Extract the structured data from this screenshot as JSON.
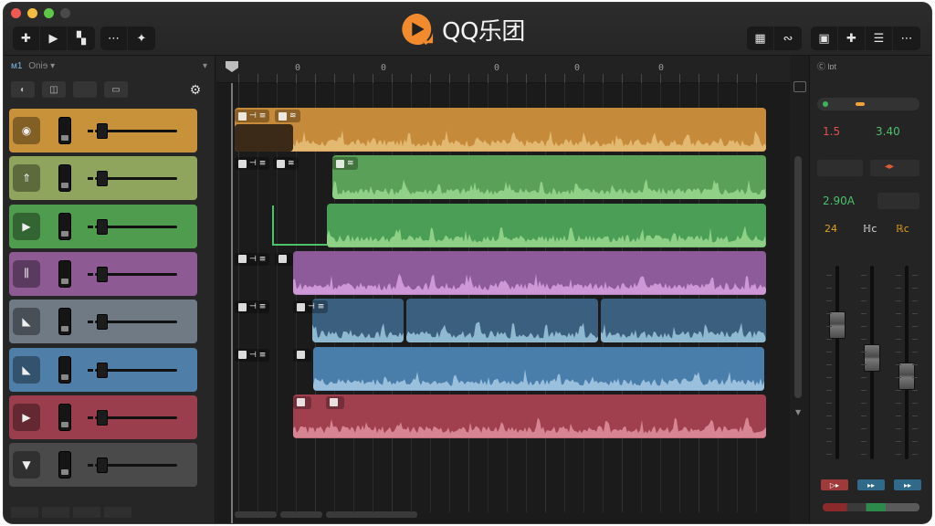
{
  "app": {
    "title": "QQ乐团",
    "colors": {
      "accent": "#f28a2e",
      "background": "#202020",
      "panel": "#262626"
    }
  },
  "toolbar_left": [
    {
      "name": "add-track-button",
      "icon": "plus-icon",
      "glyph": "✚"
    },
    {
      "name": "play-button",
      "icon": "play-icon",
      "glyph": "▶"
    },
    {
      "name": "record-button",
      "icon": "record-icon",
      "glyph": "▚"
    },
    {
      "name": "loop-button",
      "icon": "loop-icon",
      "glyph": "⋯"
    },
    {
      "name": "tuner-button",
      "icon": "tuner-icon",
      "glyph": "✦"
    }
  ],
  "toolbar_right": [
    {
      "name": "library-button",
      "icon": "library-icon",
      "glyph": "▦"
    },
    {
      "name": "tempo-button",
      "icon": "metronome-icon",
      "glyph": "∾"
    },
    {
      "name": "editor-button",
      "icon": "editor-icon",
      "glyph": "▣"
    },
    {
      "name": "mixer-button",
      "icon": "mixer-icon",
      "glyph": "✚"
    },
    {
      "name": "list-button",
      "icon": "list-icon",
      "glyph": "☰"
    },
    {
      "name": "more-button",
      "icon": "more-icon",
      "glyph": "⋯"
    }
  ],
  "tracklist": {
    "header_label": "Oniɘ",
    "header_prefix": "ᴍ1",
    "tracks": [
      {
        "name": "track-1",
        "color": "#c8923a",
        "icon_glyph": "◉"
      },
      {
        "name": "track-2",
        "color": "#8fa45c",
        "icon_glyph": "⇑"
      },
      {
        "name": "track-3",
        "color": "#4f9c4f",
        "icon_glyph": "▶"
      },
      {
        "name": "track-4",
        "color": "#8d5a94",
        "icon_glyph": "⫼"
      },
      {
        "name": "track-5",
        "color": "#6f7a85",
        "icon_glyph": "◣"
      },
      {
        "name": "track-6",
        "color": "#4f7ea8",
        "icon_glyph": "◣"
      },
      {
        "name": "track-7",
        "color": "#9a3e4d",
        "icon_glyph": "▶"
      },
      {
        "name": "track-8",
        "color": "#4a4a4a",
        "icon_glyph": "▼"
      }
    ]
  },
  "ruler": {
    "marks": [
      "0",
      "0",
      "0",
      "0",
      "0"
    ]
  },
  "clips": [
    {
      "track": 0,
      "tag": "⊣ ≡",
      "tag2": "≋",
      "color": "#c58a3a",
      "wave": "#e8c07a"
    },
    {
      "track": 1,
      "tag": "⊣ ≡",
      "tag2": "≋",
      "color": "#5aa058",
      "wave": "#9ad88f"
    },
    {
      "track": 2,
      "tag": "",
      "tag2": "",
      "color": "#4a9e55",
      "wave": "#9ad88f"
    },
    {
      "track": 3,
      "tag": "⊣ ≡",
      "tag2": "",
      "color": "#8d5b9a",
      "wave": "#d9a2e0"
    },
    {
      "track": 4,
      "tag": "⊣ ≡",
      "tag2": "⊣ ≡",
      "color": "#3b5f7e",
      "wave": "#9fc9de"
    },
    {
      "track": 5,
      "tag": "⊣ ≡",
      "tag2": "",
      "color": "#4a7eaa",
      "wave": "#a9cbe8"
    },
    {
      "track": 6,
      "tag": "",
      "tag2": "",
      "color": "#a0404f",
      "wave": "#e2929f"
    }
  ],
  "inspector": {
    "header": "Ⓒ lɒt",
    "left_value": "1.5",
    "right_value": "3.40",
    "time_value": "2.90A",
    "fx": [
      "24",
      "ℍc",
      "ℝc"
    ],
    "routes": [
      {
        "label": "▷▸",
        "color": "#a03a3a"
      },
      {
        "label": "▸▸",
        "color": "#2f6a8a"
      },
      {
        "label": "▸▸",
        "color": "#2f6a8a"
      }
    ]
  }
}
